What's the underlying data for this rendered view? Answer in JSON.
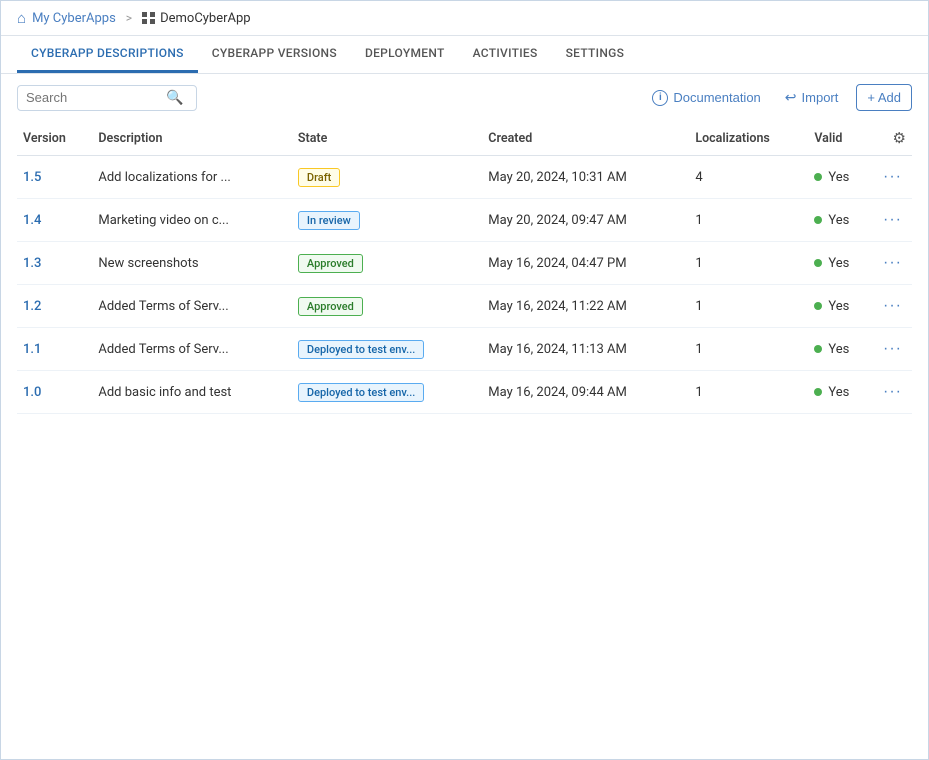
{
  "nav": {
    "home_label": "My CyberApps",
    "sep": ">",
    "current_label": "DemoCyberApp"
  },
  "tabs": [
    {
      "id": "descriptions",
      "label": "CYBERAPP DESCRIPTIONS",
      "active": true
    },
    {
      "id": "versions",
      "label": "CYBERAPP VERSIONS",
      "active": false
    },
    {
      "id": "deployment",
      "label": "DEPLOYMENT",
      "active": false
    },
    {
      "id": "activities",
      "label": "ACTIVITIES",
      "active": false
    },
    {
      "id": "settings",
      "label": "SETTINGS",
      "active": false
    }
  ],
  "toolbar": {
    "search_placeholder": "Search",
    "docs_label": "Documentation",
    "import_label": "Import",
    "add_label": "+ Add"
  },
  "table": {
    "columns": [
      {
        "id": "version",
        "label": "Version"
      },
      {
        "id": "description",
        "label": "Description"
      },
      {
        "id": "state",
        "label": "State"
      },
      {
        "id": "created",
        "label": "Created"
      },
      {
        "id": "localizations",
        "label": "Localizations"
      },
      {
        "id": "valid",
        "label": "Valid"
      },
      {
        "id": "settings",
        "label": ""
      }
    ],
    "rows": [
      {
        "version": "1.5",
        "description": "Add localizations for ...",
        "state": "Draft",
        "state_type": "draft",
        "created": "May 20, 2024, 10:31 AM",
        "localizations": "4",
        "valid": "Yes",
        "valid_ok": true
      },
      {
        "version": "1.4",
        "description": "Marketing video on c...",
        "state": "In review",
        "state_type": "inreview",
        "created": "May 20, 2024, 09:47 AM",
        "localizations": "1",
        "valid": "Yes",
        "valid_ok": true
      },
      {
        "version": "1.3",
        "description": "New screenshots",
        "state": "Approved",
        "state_type": "approved",
        "created": "May 16, 2024, 04:47 PM",
        "localizations": "1",
        "valid": "Yes",
        "valid_ok": true
      },
      {
        "version": "1.2",
        "description": "Added Terms of Serv...",
        "state": "Approved",
        "state_type": "approved",
        "created": "May 16, 2024, 11:22 AM",
        "localizations": "1",
        "valid": "Yes",
        "valid_ok": true
      },
      {
        "version": "1.1",
        "description": "Added Terms of Serv...",
        "state": "Deployed to test env...",
        "state_type": "deployed",
        "created": "May 16, 2024, 11:13 AM",
        "localizations": "1",
        "valid": "Yes",
        "valid_ok": true
      },
      {
        "version": "1.0",
        "description": "Add basic info and test",
        "state": "Deployed to test env...",
        "state_type": "deployed",
        "created": "May 16, 2024, 09:44 AM",
        "localizations": "1",
        "valid": "Yes",
        "valid_ok": true
      }
    ]
  }
}
